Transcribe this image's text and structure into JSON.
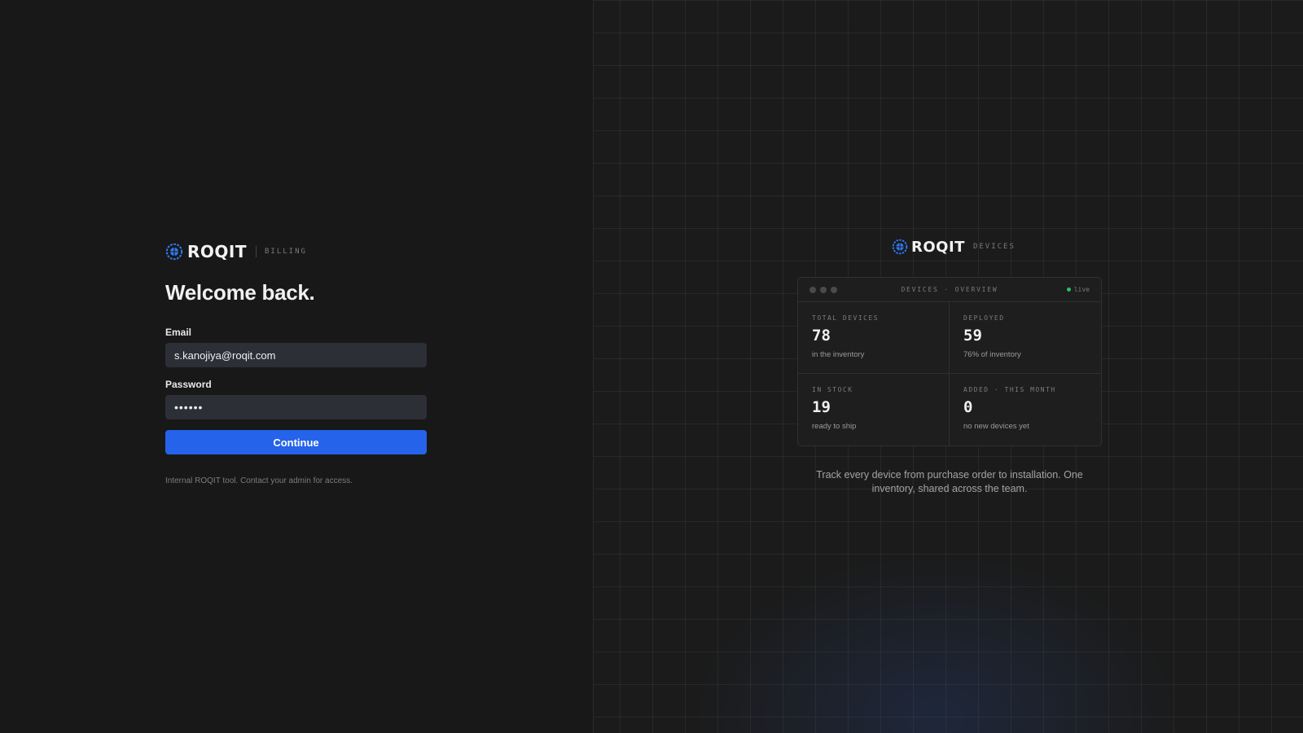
{
  "login": {
    "brand": {
      "wordmark": "ROQIT",
      "tag": "BILLING"
    },
    "title": "Welcome back.",
    "email": {
      "label": "Email",
      "value": "s.kanojiya@roqit.com"
    },
    "password": {
      "label": "Password",
      "value": "••••••"
    },
    "submit_label": "Continue",
    "footnote": "Internal ROQIT tool. Contact your admin for access."
  },
  "showcase": {
    "brand": {
      "wordmark": "ROQIT",
      "tag": "DEVICES"
    },
    "card": {
      "title": "DEVICES · OVERVIEW",
      "status": "live",
      "stats": [
        {
          "label": "TOTAL DEVICES",
          "value": "78",
          "sub": "in the inventory"
        },
        {
          "label": "DEPLOYED",
          "value": "59",
          "sub": "76% of inventory"
        },
        {
          "label": "IN STOCK",
          "value": "19",
          "sub": "ready to ship"
        },
        {
          "label": "ADDED · THIS MONTH",
          "value": "0",
          "sub": "no new devices yet"
        }
      ]
    },
    "tagline": "Track every device from purchase order to installation. One inventory, shared across the team."
  },
  "colors": {
    "accent": "#2563eb",
    "live": "#22c55e",
    "brand_mark": "#2f7bf5"
  },
  "icons": {
    "brand_mark": "roqit-logo-icon"
  }
}
